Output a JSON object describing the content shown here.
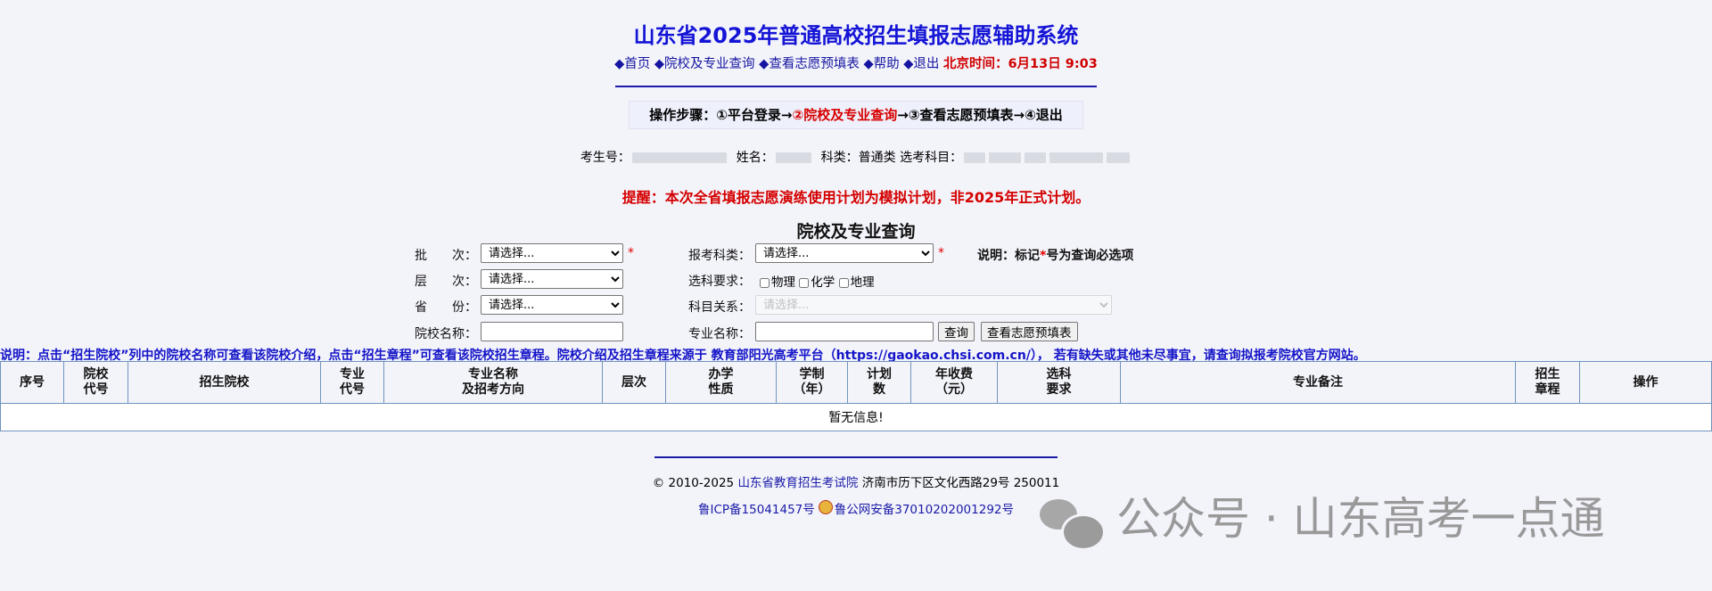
{
  "header": {
    "title": "山东省2025年普通高校招生填报志愿辅助系统",
    "nav": [
      {
        "label": "◆首页"
      },
      {
        "label": "◆院校及专业查询"
      },
      {
        "label": "◆查看志愿预填表"
      },
      {
        "label": "◆帮助"
      },
      {
        "label": "◆退出"
      }
    ],
    "time": "北京时间：6月13日 9:03"
  },
  "steps": {
    "prefix": "操作步骤：",
    "s1": "①平台登录→",
    "s2": "②院校及专业查询",
    "s3": "→③查看志愿预填表→",
    "s4": "④退出"
  },
  "candidate": {
    "id_label": "考生号：",
    "name_label": "姓名：",
    "category_label": "科类：",
    "category_value": "普通类",
    "subjects_label": "选考科目："
  },
  "warning": "提醒：本次全省填报志愿演练使用计划为模拟计划，非2025年正式计划。",
  "query": {
    "title": "院校及专业查询",
    "batch_label": "批　　次：",
    "batch_value": "请选择...",
    "level_label": "层　　次：",
    "level_value": "请选择...",
    "province_label": "省　　份：",
    "province_value": "请选择...",
    "school_label": "院校名称：",
    "school_value": "",
    "category_label": "报考科类：",
    "category_value": "请选择...",
    "subject_req_label": "选科要求：",
    "subjects": [
      "物理",
      "化学",
      "地理"
    ],
    "relation_label": "科目关系：",
    "relation_value": "请选择...",
    "major_label": "专业名称：",
    "major_value": "",
    "note_prefix": "说明：标记",
    "note_star": "*",
    "note_suffix": "号为查询必选项",
    "required_star": "*",
    "search_button": "查询",
    "view_button": "查看志愿预填表"
  },
  "note": "说明：点击“招生院校”列中的院校名称可查看该院校介绍，点击“招生章程”可查看该院校招生章程。院校介绍及招生章程来源于 教育部阳光高考平台（https://gaokao.chsi.com.cn/）， 若有缺失或其他未尽事宜，请查询拟报考院校官方网站。",
  "table": {
    "headers": [
      {
        "l1": "序号",
        "l2": ""
      },
      {
        "l1": "院校",
        "l2": "代号"
      },
      {
        "l1": "招生院校",
        "l2": ""
      },
      {
        "l1": "专业",
        "l2": "代号"
      },
      {
        "l1": "专业名称",
        "l2": "及招考方向"
      },
      {
        "l1": "层次",
        "l2": ""
      },
      {
        "l1": "办学",
        "l2": "性质"
      },
      {
        "l1": "学制",
        "l2": "（年）"
      },
      {
        "l1": "计划",
        "l2": "数"
      },
      {
        "l1": "年收费",
        "l2": "（元）"
      },
      {
        "l1": "选科",
        "l2": "要求"
      },
      {
        "l1": "专业备注",
        "l2": ""
      },
      {
        "l1": "招生",
        "l2": "章程"
      },
      {
        "l1": "操作",
        "l2": ""
      }
    ],
    "empty": "暂无信息!"
  },
  "footer": {
    "copyright": "© 2010-2025",
    "org": "山东省教育招生考试院",
    "address": "济南市历下区文化西路29号 250011",
    "icp": "鲁ICP备15041457号",
    "police": "鲁公网安备37010202001292号"
  },
  "watermark": "公众号 · 山东高考一点通"
}
